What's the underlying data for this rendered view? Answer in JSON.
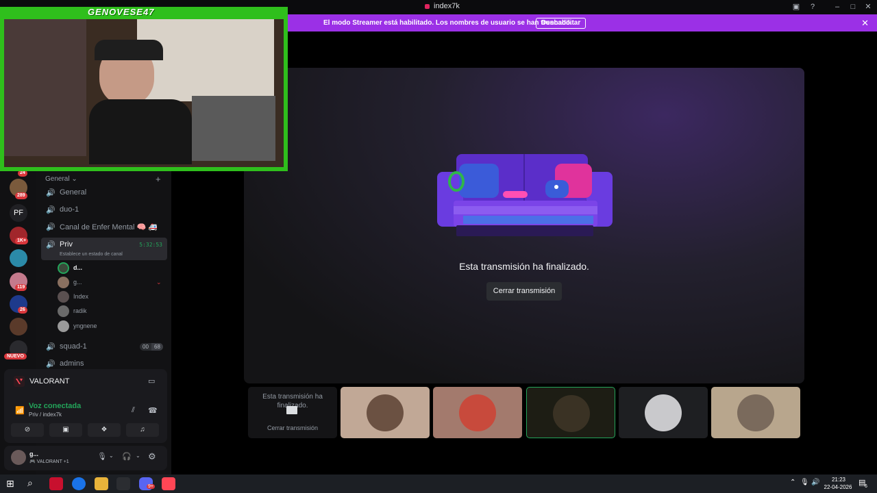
{
  "window": {
    "title": "index7k"
  },
  "banner": {
    "message": "El modo Streamer está habilitado. Los nombres de usuario se han truncado.",
    "button": "Deshabilitar",
    "close_glyph": "✕"
  },
  "overlay": {
    "streamer_name": "GENOVESE47"
  },
  "rail": {
    "badges": [
      "24",
      "289",
      "1K+",
      "119",
      "26"
    ],
    "new_label": "NUEVO",
    "short_name": "PF"
  },
  "sidebar": {
    "category": "General",
    "add_glyph": "+",
    "channels": [
      {
        "name": "General"
      },
      {
        "name": "duo-1"
      },
      {
        "name": "Canal de Enfer Mental 🧠 🚑"
      },
      {
        "name": "Priv",
        "status": "Establece un estado de canal",
        "time": "5:32:53"
      },
      {
        "name": "squad-1",
        "count_a": "00",
        "count_b": "68"
      },
      {
        "name": "admins"
      }
    ],
    "members": [
      "d...",
      "g...",
      "Index",
      "radik",
      "yngnene"
    ]
  },
  "voice": {
    "activity": "VALORANT",
    "status": "Voz conectada",
    "location": "Priv / index7k"
  },
  "user": {
    "name": "g...",
    "activity": "VALORANT +1"
  },
  "stage": {
    "ended_text": "Esta transmisión ha finalizado.",
    "close_button": "Cerrar transmisión"
  },
  "tiles": {
    "first_ended_text": "Esta transmisión ha finalizado.",
    "first_close": "Cerrar transmisión"
  },
  "taskbar": {
    "time": "21:23",
    "date": "22-04-2026",
    "notif_count": "6",
    "app_badge": "9+"
  },
  "colors": {
    "brand": "#5865f2",
    "streamer": "#9b30e6",
    "online": "#23a55a",
    "danger": "#da373c"
  }
}
